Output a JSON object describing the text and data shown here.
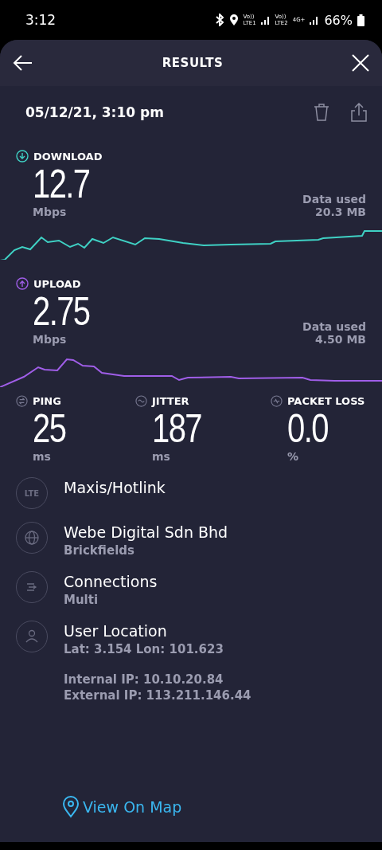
{
  "status_bar": {
    "time": "3:12",
    "sim_labels": [
      {
        "top": "Vo))",
        "bottom": "LTE1"
      },
      {
        "top": "Vo))",
        "bottom": "LTE2"
      }
    ],
    "network_type": "4G+",
    "battery": "66%"
  },
  "header": {
    "title": "RESULTS"
  },
  "result": {
    "timestamp": "05/12/21, 3:10 pm"
  },
  "speeds": [
    {
      "kind": "download",
      "label": "DOWNLOAD",
      "value": "12.7",
      "unit": "Mbps",
      "data_label": "Data used",
      "data_value": "20.3 MB",
      "color": "#3fd1c4"
    },
    {
      "kind": "upload",
      "label": "UPLOAD",
      "value": "2.75",
      "unit": "Mbps",
      "data_label": "Data used",
      "data_value": "4.50 MB",
      "color": "#a05ee8"
    }
  ],
  "metrics": [
    {
      "kind": "ping",
      "label": "PING",
      "value": "25",
      "unit": "ms"
    },
    {
      "kind": "jitter",
      "label": "JITTER",
      "value": "187",
      "unit": "ms"
    },
    {
      "kind": "loss",
      "label": "PACKET LOSS",
      "value": "0.0",
      "unit": "%"
    }
  ],
  "info": [
    {
      "kind": "lte",
      "icon_text": "LTE",
      "title": "Maxis/Hotlink"
    },
    {
      "kind": "globe",
      "title": "Webe Digital Sdn Bhd",
      "subtitle": "Brickfields"
    },
    {
      "kind": "connections",
      "title": "Connections",
      "subtitle": "Multi"
    },
    {
      "kind": "user",
      "title": "User Location",
      "subtitle": "Lat: 3.154 Lon: 101.623",
      "details": [
        "Internal IP: 10.10.20.84",
        "External IP: 113.211.146.44"
      ]
    }
  ],
  "map_link": "View On Map"
}
